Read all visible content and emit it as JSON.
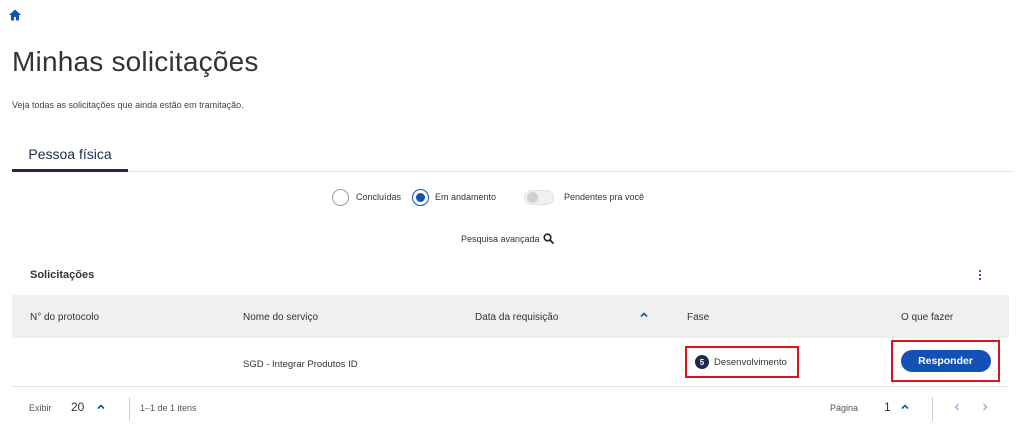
{
  "header": {
    "home_icon": "home-icon",
    "title": "Minhas solicitações",
    "subtitle": "Veja todas as solicitações que ainda estão em tramitação."
  },
  "tabs": [
    {
      "label": "Pessoa física",
      "active": true
    }
  ],
  "filters": {
    "completed_label": "Concluídas",
    "in_progress_label": "Em andamento",
    "selected": "Em andamento",
    "pending_label": "Pendentes pra você",
    "pending_on": false
  },
  "advanced_search": {
    "label": "Pesquisa avançada",
    "icon": "search-icon"
  },
  "section": {
    "title": "Solicitações",
    "menu_icon": "kebab-menu-icon"
  },
  "table": {
    "columns": [
      "N° do protocolo",
      "Nome do serviço",
      "Data da requisição",
      "Fase",
      "O que fazer"
    ],
    "rows": [
      {
        "protocol": "",
        "service": "SGD - Integrar Produtos ID",
        "date": "",
        "phase_number": "5",
        "phase_label": "Desenvolvimento",
        "action_label": "Responder"
      }
    ]
  },
  "pagination": {
    "show_label": "Exibir",
    "page_size": "20",
    "range_text": "1–1 de 1 itens",
    "page_label": "Página",
    "current_page": "1"
  },
  "colors": {
    "primary": "#1351b4",
    "dark": "#1c2a48",
    "highlight": "#e0121d",
    "header_bg": "#f0f0f0"
  }
}
